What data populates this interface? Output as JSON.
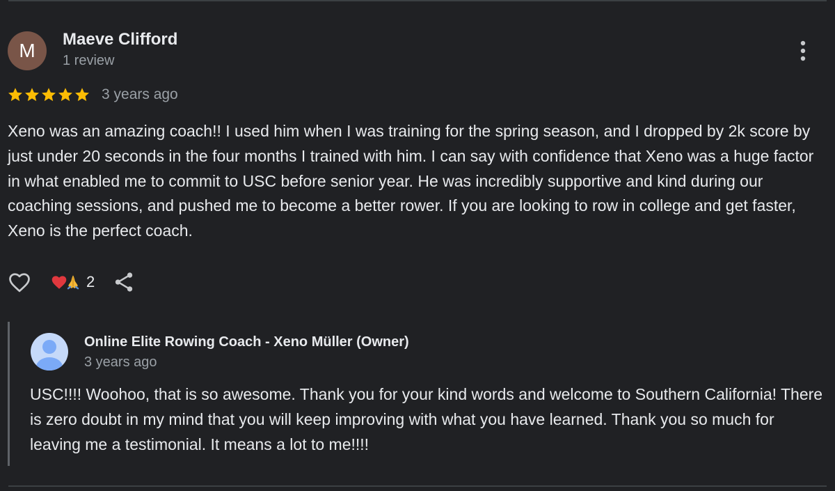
{
  "review": {
    "avatar_initial": "M",
    "reviewer_name": "Maeve Clifford",
    "review_count": "1 review",
    "rating": 5,
    "rating_max": 5,
    "date": "3 years ago",
    "text": "Xeno was an amazing coach!! I used him when I was training for the spring season, and I dropped by 2k score by just under 20 seconds in the four months I trained with him. I can say with confidence that Xeno was a huge factor in what enabled me to commit to USC before senior year. He was incredibly supportive and kind during our coaching sessions, and pushed me to become a better rower. If you are looking to row in college and get faster, Xeno is the perfect coach.",
    "avatar_color": "#795548",
    "star_color": "#fbbc04"
  },
  "actions": {
    "like_icon": "heart-outline-icon",
    "reaction_emojis": [
      "heart-emoji",
      "pray-emoji"
    ],
    "reaction_count": "2",
    "share_icon": "share-icon",
    "more_icon": "more-vertical-icon"
  },
  "owner_reply": {
    "name": "Online Elite Rowing Coach - Xeno Müller (Owner)",
    "date": "3 years ago",
    "text": "USC!!!! Woohoo, that is so awesome. Thank you for your kind words and welcome to Southern California! There is zero doubt in my mind that you will keep improving with what you have learned. Thank you so much for leaving me a testimonial. It means a lot to me!!!!",
    "avatar_icon": "default-profile-icon",
    "avatar_color": "#7baaf7"
  }
}
